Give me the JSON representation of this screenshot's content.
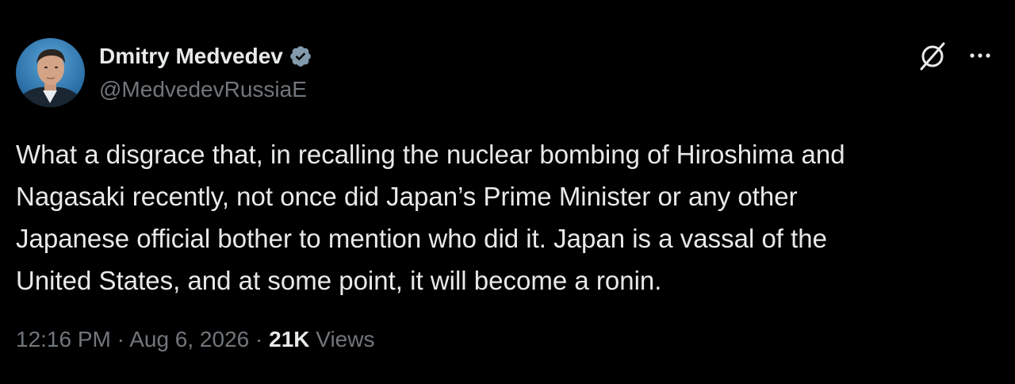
{
  "author": {
    "name": "Dmitry Medvedev",
    "handle": "@MedvedevRussiaE",
    "verified": true,
    "verified_color": "#829aab"
  },
  "icons": {
    "grok": "grok-slash-circle-icon",
    "more": "more-horizontal-icon"
  },
  "tweet": {
    "text_lines": [
      "What a disgrace that, in recalling the nuclear bombing of Hiroshima and",
      "Nagasaki recently, not once did Japan’s Prime Minister or any other",
      "Japanese official bother to mention who did it. Japan is a vassal of the",
      "United States, and at some point, it will become a ronin."
    ]
  },
  "meta": {
    "time": "12:16 PM",
    "separator": "·",
    "date": "Aug 6, 2026",
    "views_count": "21K",
    "views_label": "Views"
  },
  "colors": {
    "background": "#000000",
    "text_primary": "#e7e9ea",
    "text_secondary": "#71767b"
  }
}
